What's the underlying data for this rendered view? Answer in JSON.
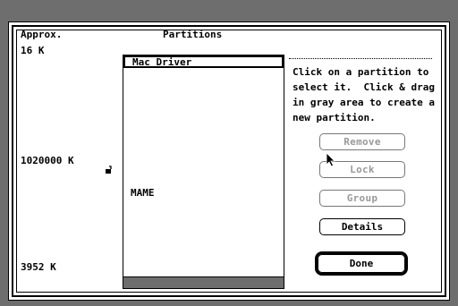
{
  "dialog": {
    "column_headers": {
      "size": "Approx.",
      "partitions": "Partitions"
    },
    "sizes": {
      "first": "16 K",
      "second": "1020000 K",
      "free": "3952 K"
    },
    "partitions": [
      {
        "name": "Mac Driver",
        "selected": true
      },
      {
        "name": "MAME",
        "selected": false,
        "locked": true
      }
    ],
    "instructions": "Click on a partition to\nselect it.  Click & drag\nin gray area to create a\nnew partition.",
    "buttons": {
      "remove": "Remove",
      "lock": "Lock",
      "group": "Group",
      "details": "Details",
      "done": "Done"
    },
    "icons": {
      "lock": "lock-icon",
      "cursor": "arrow-cursor-icon"
    }
  }
}
